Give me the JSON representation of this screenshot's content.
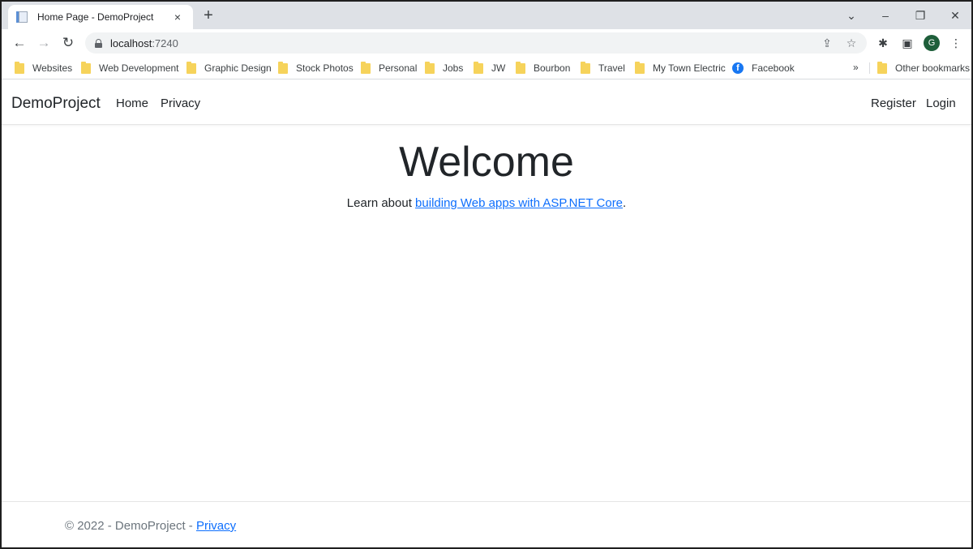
{
  "browser": {
    "tab": {
      "title": "Home Page - DemoProject",
      "favicon": "page-icon",
      "close_icon": "×"
    },
    "new_tab_icon": "+",
    "window_controls": {
      "tab_search": "⌄",
      "minimize": "–",
      "restore": "❐",
      "close": "✕"
    },
    "nav": {
      "back": "←",
      "forward": "→",
      "reload": "↻"
    },
    "address": {
      "host": "localhost",
      "port": ":7240"
    },
    "omnibox_icons": {
      "share": "⇪",
      "star": "☆"
    },
    "toolbar_icons": {
      "extensions": "✱",
      "side_panel": "▣",
      "menu": "⋮"
    },
    "profile_initial": "G",
    "bookmarks": [
      {
        "label": "Websites",
        "icon": "folder-icon"
      },
      {
        "label": "Web Development",
        "icon": "folder-icon"
      },
      {
        "label": "Graphic Design",
        "icon": "folder-icon"
      },
      {
        "label": "Stock Photos",
        "icon": "folder-icon"
      },
      {
        "label": "Personal",
        "icon": "folder-icon"
      },
      {
        "label": "Jobs",
        "icon": "folder-icon"
      },
      {
        "label": "JW",
        "icon": "folder-icon"
      },
      {
        "label": "Bourbon",
        "icon": "folder-icon"
      },
      {
        "label": "Travel",
        "icon": "folder-icon"
      },
      {
        "label": "My Town Electric",
        "icon": "folder-icon"
      },
      {
        "label": "Facebook",
        "icon": "facebook-icon"
      }
    ],
    "bookmarks_more": "»",
    "other_bookmarks": "Other bookmarks"
  },
  "page": {
    "navbar": {
      "brand": "DemoProject",
      "links": [
        "Home",
        "Privacy"
      ],
      "right_links": [
        "Register",
        "Login"
      ]
    },
    "main": {
      "heading": "Welcome",
      "lead_prefix": "Learn about ",
      "lead_link": "building Web apps with ASP.NET Core",
      "lead_suffix": "."
    },
    "footer": {
      "text": "© 2022 - DemoProject - ",
      "link": "Privacy"
    }
  },
  "colors": {
    "link": "#0d6efd",
    "tabstrip": "#dee1e6",
    "folder": "#f6d35b",
    "profile": "#1e5e3a"
  }
}
